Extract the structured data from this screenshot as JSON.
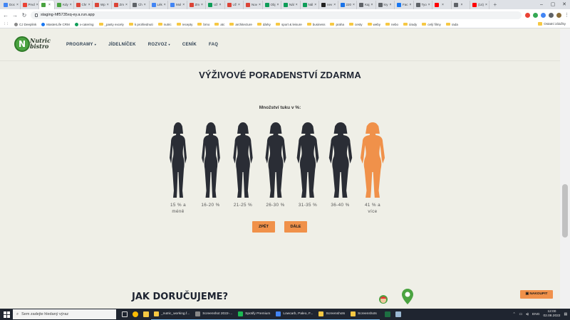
{
  "browser": {
    "tabs": [
      {
        "label": "Doc",
        "color": "#4285f4"
      },
      {
        "label": "Prvd",
        "color": "#ea4335"
      },
      {
        "label": "",
        "color": "#4aa340",
        "active": true
      },
      {
        "label": "Kdy",
        "color": "#4aa340"
      },
      {
        "label": "Chr",
        "color": "#db4437"
      },
      {
        "label": "Wp",
        "color": "#db4437"
      },
      {
        "label": "Zm",
        "color": "#db4437"
      },
      {
        "label": "Ch",
        "color": "#5f6368"
      },
      {
        "label": "Lék",
        "color": "#4285f4"
      },
      {
        "label": "Mol",
        "color": "#4285f4"
      },
      {
        "label": "Zm",
        "color": "#db4437"
      },
      {
        "label": "Už",
        "color": "#0f9d58"
      },
      {
        "label": "Už",
        "color": "#db4437"
      },
      {
        "label": "Nov",
        "color": "#db4437"
      },
      {
        "label": "Obj",
        "color": "#0f9d58"
      },
      {
        "label": "Nál",
        "color": "#0f9d58"
      },
      {
        "label": "Nál",
        "color": "#0f9d58"
      },
      {
        "label": "nev",
        "color": "#222222"
      },
      {
        "label": "220",
        "color": "#1a73e8"
      },
      {
        "label": "Kaj",
        "color": "#5f6368"
      },
      {
        "label": "kry",
        "color": "#5f6368"
      },
      {
        "label": "Fac",
        "color": "#1877f2"
      },
      {
        "label": "Tyo",
        "color": "#5f6368"
      },
      {
        "label": "",
        "color": "#ff0000"
      },
      {
        "label": "",
        "color": "#5f6368"
      },
      {
        "label": "(14)",
        "color": "#ff0000"
      }
    ],
    "new_tab": "+",
    "url": "staging-hff5735xq-ey.a.run.app",
    "bookmarks": [
      {
        "label": "CJ Deeplink",
        "type": "icon",
        "color": "#888"
      },
      {
        "label": "MasterLife CRM",
        "type": "icon",
        "color": "#1877f2"
      },
      {
        "label": "x-catering",
        "type": "icon",
        "color": "#0f9d58"
      },
      {
        "label": "_pasty excely",
        "type": "folder"
      },
      {
        "label": "k prohlednuti",
        "type": "folder"
      },
      {
        "label": "nutric",
        "type": "folder"
      },
      {
        "label": "recepty",
        "type": "folder"
      },
      {
        "label": "brno",
        "type": "folder"
      },
      {
        "label": "atc",
        "type": "folder"
      },
      {
        "label": "architecture",
        "type": "folder"
      },
      {
        "label": "dárky",
        "type": "folder"
      },
      {
        "label": "sport & leisure",
        "type": "folder"
      },
      {
        "label": "business",
        "type": "folder"
      },
      {
        "label": "praha",
        "type": "folder"
      },
      {
        "label": "cesty",
        "type": "folder"
      },
      {
        "label": "weby",
        "type": "folder"
      },
      {
        "label": "nebo",
        "type": "folder"
      },
      {
        "label": "úrady",
        "type": "folder"
      },
      {
        "label": "celý filmy",
        "type": "folder"
      },
      {
        "label": "rada",
        "type": "folder"
      }
    ],
    "other_bookmarks": "Ostatní záložky"
  },
  "site": {
    "logo": {
      "badge": "N",
      "line1": "Nutric",
      "line2": "bistro"
    },
    "menu": [
      {
        "label": "PROGRAMY",
        "dropdown": true
      },
      {
        "label": "JÍDELNÍČEK",
        "dropdown": false
      },
      {
        "label": "ROZVOZ",
        "dropdown": true
      },
      {
        "label": "CENÍK",
        "dropdown": false
      },
      {
        "label": "FAQ",
        "dropdown": false
      }
    ],
    "title": "VÝŽIVOVÉ PORADENSTVÍ ZDARMA",
    "question": "Množství tuku v %:",
    "figures": [
      {
        "caption_line1": "15 % a",
        "caption_line2": "méně",
        "selected": false
      },
      {
        "caption_line1": "16-20 %",
        "caption_line2": "",
        "selected": false
      },
      {
        "caption_line1": "21-25 %",
        "caption_line2": "",
        "selected": false
      },
      {
        "caption_line1": "26-30 %",
        "caption_line2": "",
        "selected": false
      },
      {
        "caption_line1": "31-35 %",
        "caption_line2": "",
        "selected": false
      },
      {
        "caption_line1": "36-40 %",
        "caption_line2": "",
        "selected": false
      },
      {
        "caption_line1": "41 % a",
        "caption_line2": "více",
        "selected": true
      }
    ],
    "back_label": "ZPĚT",
    "next_label": "DÁLE",
    "delivery_title": "JAK DORUČUJEME?",
    "order_label": "NAKOUPIT",
    "colors": {
      "accent": "#f0914a",
      "figure": "#2a2d35",
      "background": "#efefe7"
    }
  },
  "taskbar": {
    "search_placeholder": "Sem zadejte hledaný výraz",
    "apps": [
      {
        "label": "_nutric_working.f...",
        "color": "#f6c843"
      },
      {
        "label": "Screenshot 2022-...",
        "color": "#888888"
      },
      {
        "label": "Spotify Premium",
        "color": "#1db954"
      },
      {
        "label": "Lowcarb, Paleo, F...",
        "color": "#4285f4"
      },
      {
        "label": "Screenshots",
        "color": "#f6c843"
      },
      {
        "label": "Screenshots",
        "color": "#f6c843"
      }
    ],
    "language": "ENG",
    "time": "12:00",
    "date": "02.08.2022"
  }
}
